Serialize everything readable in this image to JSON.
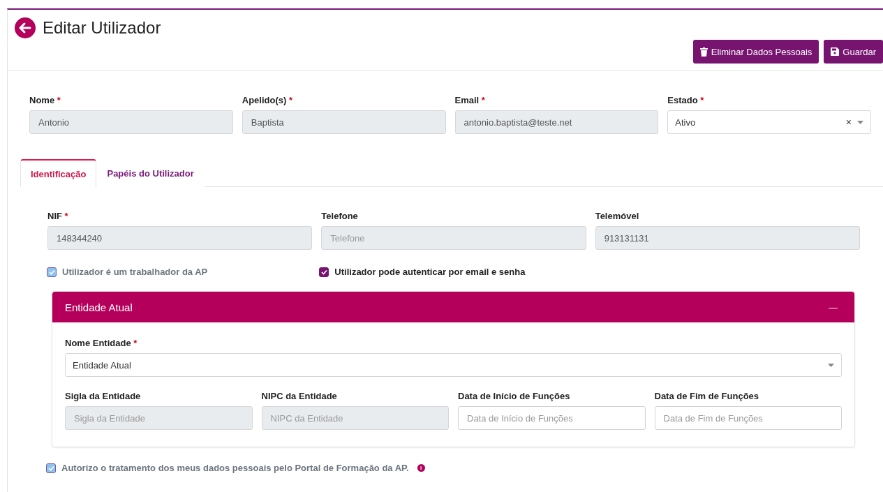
{
  "header": {
    "title": "Editar Utilizador",
    "buttons": [
      {
        "kind": "delete",
        "label": "Eliminar Dados Pessoais"
      },
      {
        "kind": "save",
        "label": "Guardar"
      }
    ]
  },
  "top_fields": [
    {
      "kind": "input",
      "label": "Nome",
      "required": "*",
      "value": "Antonio",
      "disabled": true
    },
    {
      "kind": "input",
      "label": "Apelido(s)",
      "required": "*",
      "value": "Baptista",
      "disabled": true
    },
    {
      "kind": "input",
      "label": "Email",
      "required": "*",
      "value": "antonio.baptista@teste.net",
      "disabled": true
    },
    {
      "kind": "select",
      "label": "Estado",
      "required": "*",
      "value": "Ativo",
      "clear": "×"
    }
  ],
  "tabs": [
    {
      "label": "Identificação",
      "selected": true
    },
    {
      "label": "Papéis do Utilizador",
      "selected": false
    }
  ],
  "identification_fields": [
    {
      "label": "NIF",
      "required": "*",
      "value": "148344240",
      "disabled": true
    },
    {
      "label": "Telefone",
      "placeholder": "Telefone",
      "disabled": true
    },
    {
      "label": "Telemóvel",
      "value": "913131131",
      "disabled": true
    }
  ],
  "checkboxes": [
    {
      "label": "Utilizador é um trabalhador da AP",
      "checked": true,
      "disabled": true
    },
    {
      "label": "Utilizador pode autenticar por email e senha",
      "checked": true,
      "disabled": false
    }
  ],
  "entity_panel": {
    "title": "Entidade Atual",
    "collapse": "—",
    "entity_field": {
      "kind": "select",
      "label": "Nome Entidade",
      "required": "*",
      "value": "Entidade Atual"
    },
    "fields": [
      {
        "label": "Sigla da Entidade",
        "placeholder": "Sigla da Entidade",
        "disabled": true
      },
      {
        "label": "NIPC da Entidade",
        "placeholder": "NIPC da Entidade",
        "disabled": true
      },
      {
        "label": "Data de Início de Funções",
        "placeholder": "Data de Início de Funções",
        "disabled": false
      },
      {
        "label": "Data de Fim de Funções",
        "placeholder": "Data de Fim de Funções",
        "disabled": false
      }
    ]
  },
  "consent": {
    "label": "Autorizo o tratamento dos meus dados pessoais pelo Portal de Formação da AP.",
    "checked": true,
    "disabled": true,
    "info": "i"
  }
}
